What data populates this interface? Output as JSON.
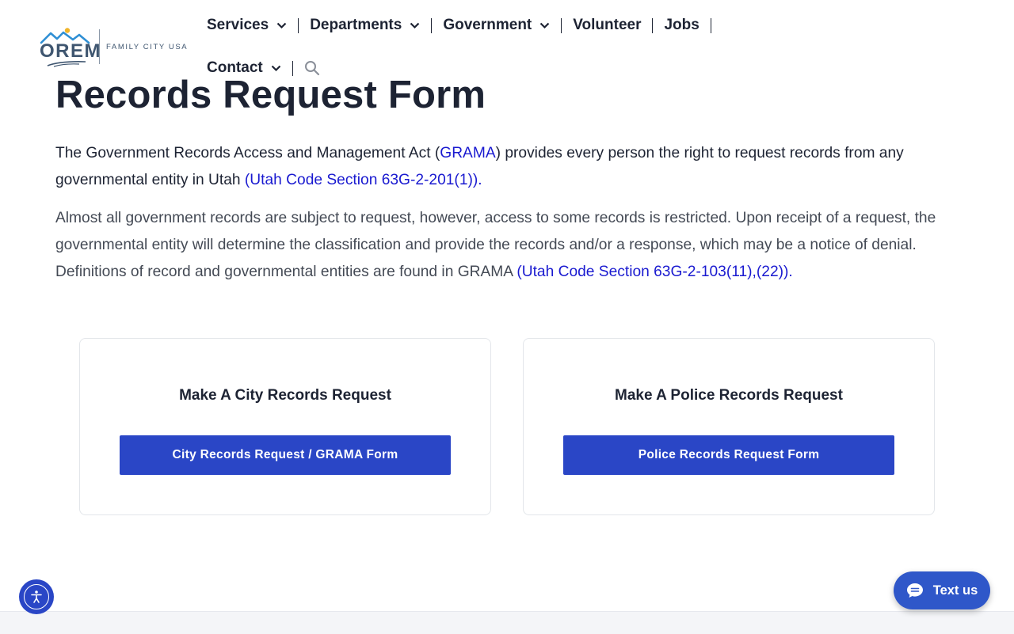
{
  "brand": {
    "logo_text": "OREM",
    "tagline": "FAMILY CITY USA",
    "colors": {
      "logo": "#3f5670",
      "accent": "#2a46c6",
      "link": "#1a1ad0"
    }
  },
  "nav": {
    "row1": [
      {
        "label": "Services",
        "has_dropdown": true
      },
      {
        "label": "Departments",
        "has_dropdown": true
      },
      {
        "label": "Government",
        "has_dropdown": true
      },
      {
        "label": "Volunteer",
        "has_dropdown": false
      },
      {
        "label": "Jobs",
        "has_dropdown": false
      }
    ],
    "row2": [
      {
        "label": "Contact",
        "has_dropdown": true
      }
    ],
    "search_icon": "search-icon"
  },
  "page": {
    "title": "Records Request Form",
    "intro": {
      "t1": "The Government Records Access and Management Act (",
      "link1": "GRAMA",
      "t2": ") provides every person the right to request records from any governmental entity in Utah ",
      "link2": "(Utah Code Section 63G-2-201(1))."
    },
    "detail": {
      "t1": "Almost all government records are subject to request, however, access to some records is restricted. Upon receipt of a request, the governmental entity will determine the classification and provide the records and/or a response, which may be a notice of denial. Definitions of record and governmental entities are found in GRAMA ",
      "link1": "(Utah Code Section 63G-2-103(11),(22))."
    }
  },
  "cards": [
    {
      "heading": "Make A City Records Request",
      "button": "City Records Request / GRAMA Form"
    },
    {
      "heading": "Make A Police Records Request",
      "button": "Police Records Request Form"
    }
  ],
  "widgets": {
    "accessibility_icon": "accessibility-icon",
    "text_us": "Text us",
    "chat_icon": "chat-icon"
  }
}
